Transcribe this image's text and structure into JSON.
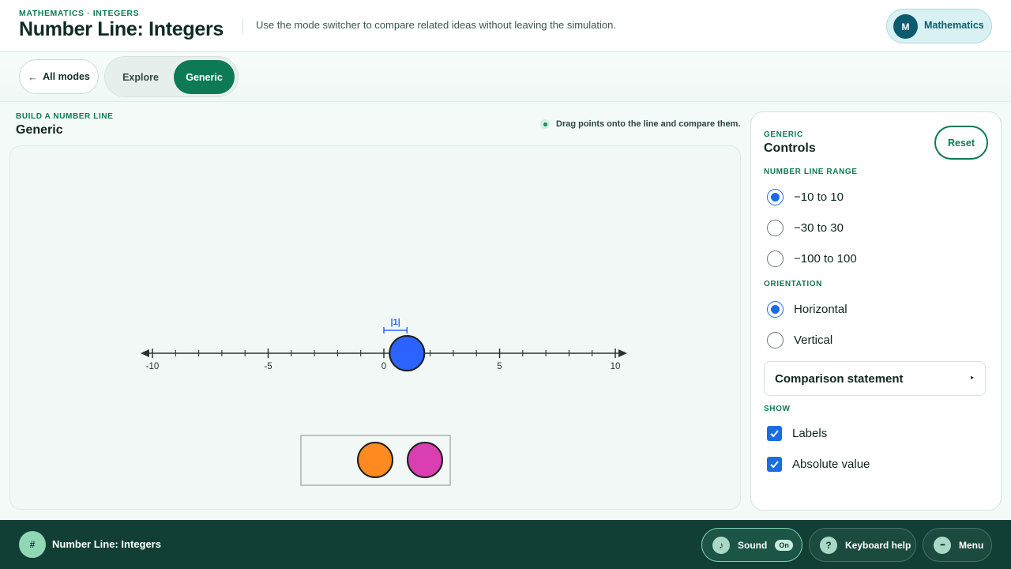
{
  "header": {
    "eyebrow": "MATHEMATICS · INTEGERS",
    "title": "Number Line: Integers",
    "subtitle": "Use the mode switcher to compare related ideas without leaving the simulation.",
    "subject": {
      "avatar": "M",
      "label": "Mathematics"
    }
  },
  "modebar": {
    "all_modes": "All modes",
    "back_icon": "←",
    "tabs": [
      {
        "label": "Explore",
        "active": false
      },
      {
        "label": "Generic",
        "active": true
      }
    ]
  },
  "main": {
    "eyebrow": "BUILD A NUMBER LINE",
    "title": "Generic",
    "hint": "Drag points onto the line and compare them."
  },
  "number_line": {
    "min": -10,
    "max": 10,
    "major_ticks": [
      {
        "value": -10,
        "label": "-10"
      },
      {
        "value": -5,
        "label": "-5"
      },
      {
        "value": 0,
        "label": "0"
      },
      {
        "value": 5,
        "label": "5"
      },
      {
        "value": 10,
        "label": "10"
      }
    ],
    "point": {
      "value": 1,
      "color": "#2c63ff"
    },
    "absolute_value_label": "|1|",
    "tray_points": [
      {
        "color": "#ff8a1f"
      },
      {
        "color": "#d93fb0"
      }
    ]
  },
  "controls": {
    "eyebrow": "GENERIC",
    "title": "Controls",
    "reset": "Reset",
    "range_label": "NUMBER LINE RANGE",
    "range_options": [
      {
        "label": "−10 to 10",
        "selected": true
      },
      {
        "label": "−30 to 30",
        "selected": false
      },
      {
        "label": "−100 to 100",
        "selected": false
      }
    ],
    "orientation_label": "ORIENTATION",
    "orientation_options": [
      {
        "label": "Horizontal",
        "selected": true
      },
      {
        "label": "Vertical",
        "selected": false
      }
    ],
    "comparison": "Comparison statement",
    "comparison_caret": "▸",
    "show_label": "SHOW",
    "show_options": [
      {
        "label": "Labels",
        "checked": true
      },
      {
        "label": "Absolute value",
        "checked": true
      }
    ]
  },
  "footer": {
    "logo": "#",
    "title": "Number Line: Integers",
    "sound": {
      "label": "Sound",
      "icon": "♪",
      "state": "On"
    },
    "keyboard": {
      "label": "Keyboard help",
      "icon": "?"
    },
    "menu": {
      "label": "Menu",
      "icon": "•••"
    }
  },
  "colors": {
    "accent": "#0e7a55",
    "footer": "#123f35",
    "selection": "#1a6de0"
  }
}
